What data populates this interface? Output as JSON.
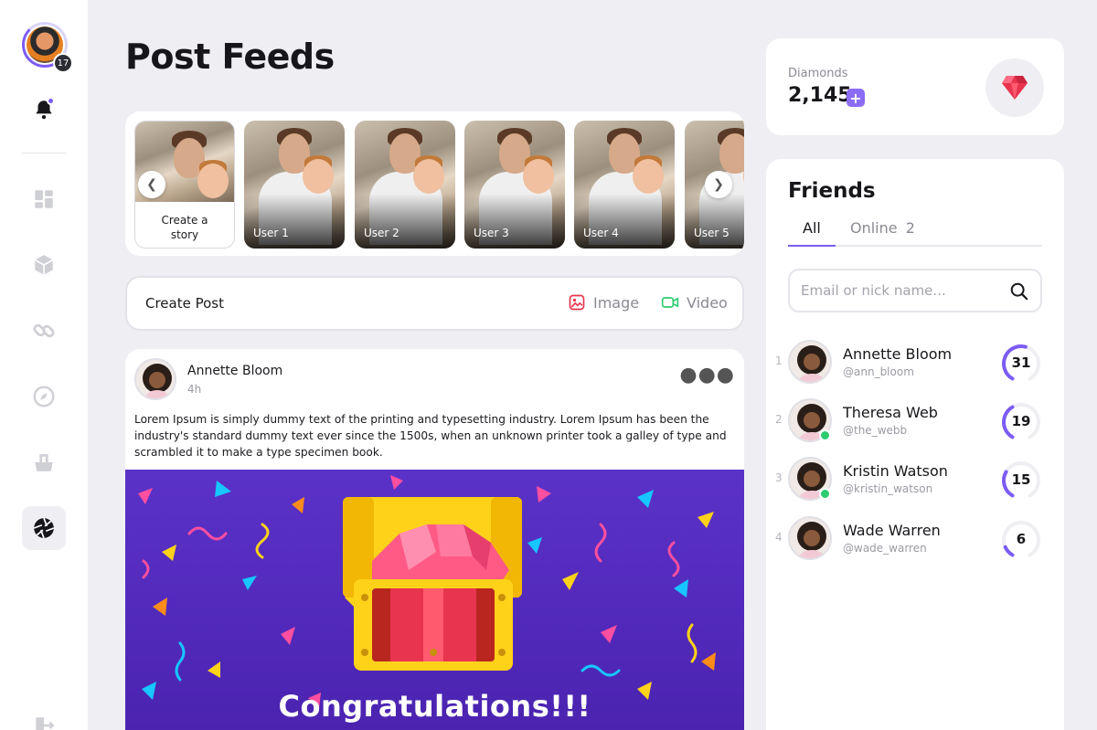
{
  "sidebar": {
    "level": "17",
    "icons": [
      "bell-icon",
      "dashboard-icon",
      "box-icon",
      "link-icon",
      "compass-icon",
      "basket-icon",
      "aperture-icon",
      "logout-icon"
    ]
  },
  "page": {
    "title": "Post Feeds"
  },
  "stories": {
    "create_label": "Create a story",
    "users": [
      "User 1",
      "User 2",
      "User 3",
      "User 4",
      "User 5"
    ]
  },
  "create_post": {
    "label": "Create Post",
    "image_label": "Image",
    "video_label": "Video"
  },
  "post": {
    "author": "Annette Bloom",
    "time": "4h",
    "text": "Lorem Ipsum is simply dummy text of the printing and typesetting industry. Lorem Ipsum has been the industry's standard dummy text ever since the 1500s, when an unknown printer took a galley of type and scrambled it to make a type specimen book.",
    "banner_text": "Congratulations!!!"
  },
  "diamonds": {
    "label": "Diamonds",
    "value": "2,145",
    "plus": "+"
  },
  "friends": {
    "title": "Friends",
    "tabs": {
      "all": "All",
      "online": "Online",
      "online_count": "2"
    },
    "search_placeholder": "Email or nick name...",
    "list": [
      {
        "rank": "1",
        "name": "Annette Bloom",
        "handle": "@ann_bloom",
        "score": "31",
        "online": false,
        "progress": 0.55
      },
      {
        "rank": "2",
        "name": "Theresa Web",
        "handle": "@the_webb",
        "score": "19",
        "online": true,
        "progress": 0.4
      },
      {
        "rank": "3",
        "name": "Kristin Watson",
        "handle": "@kristin_watson",
        "score": "15",
        "online": true,
        "progress": 0.3
      },
      {
        "rank": "4",
        "name": "Wade Warren",
        "handle": "@wade_warren",
        "score": "6",
        "online": false,
        "progress": 0.12
      }
    ]
  },
  "colors": {
    "accent": "#7c5cf5",
    "online": "#2ecc71",
    "image_icon": "#e8344e",
    "video_icon": "#2ecc71",
    "banner": "#5b32c8"
  }
}
